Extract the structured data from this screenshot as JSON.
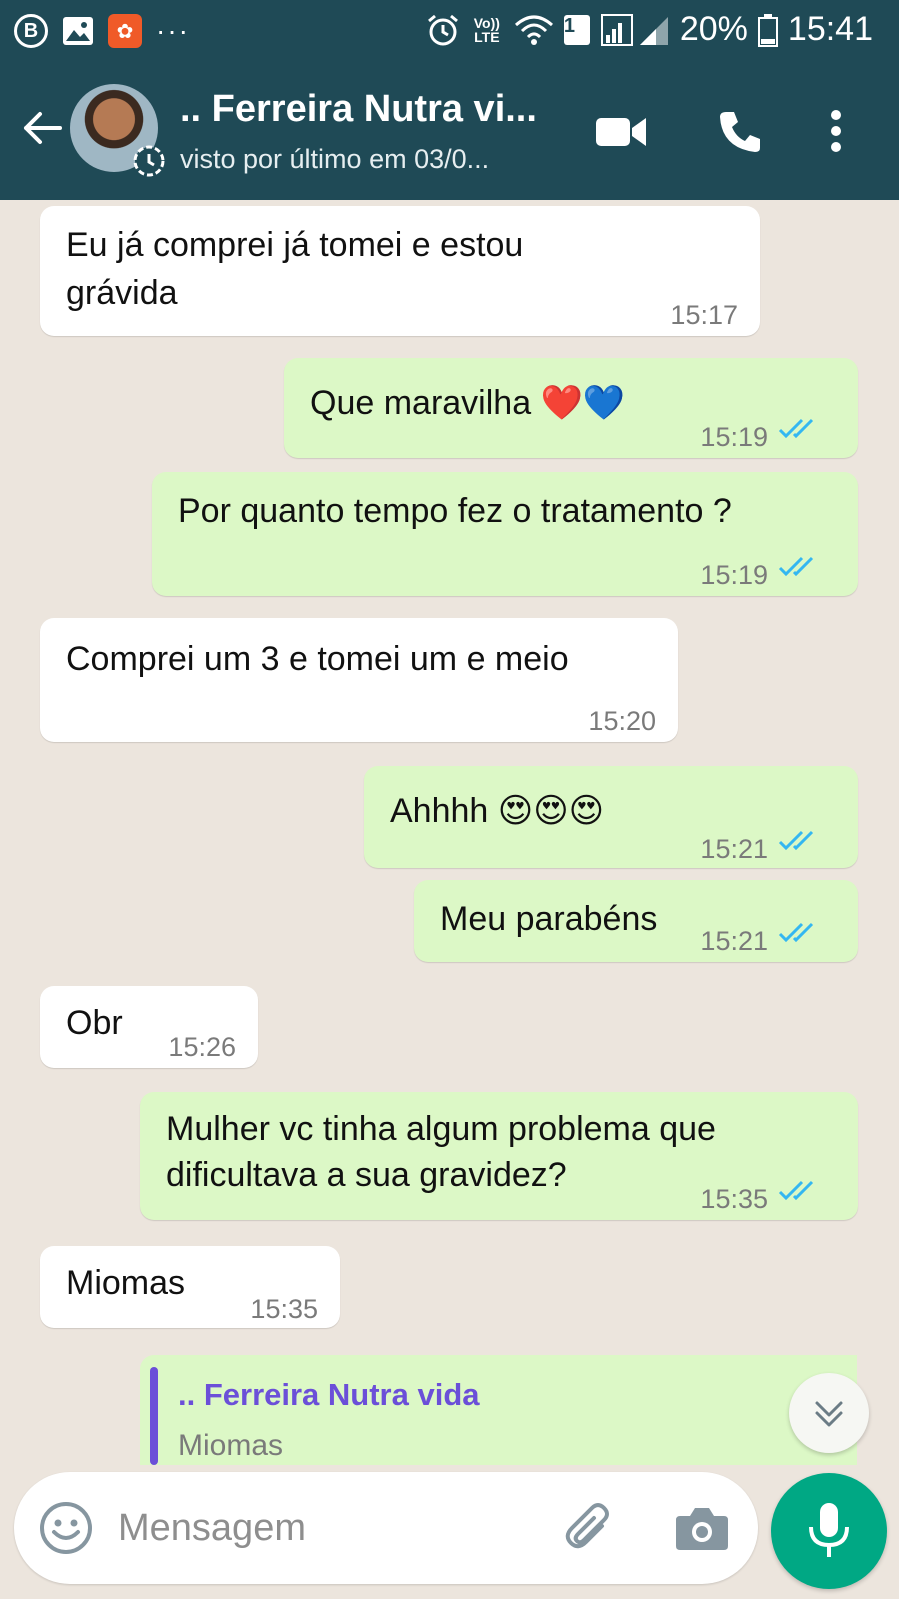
{
  "status_bar": {
    "battery": "20%",
    "time": "15:41",
    "volte": "Vo)) LTE",
    "sim": "1",
    "app_badge_letter": "B",
    "more_dots": "···"
  },
  "header": {
    "contact_name": ".. Ferreira Nutra vi...",
    "last_seen": "visto por último em 03/0...",
    "background_color": "#1f4a56"
  },
  "messages": [
    {
      "dir": "in",
      "lines": [
        "Eu já comprei já tomei e estou",
        "grávida"
      ],
      "time": "15:17"
    },
    {
      "dir": "out",
      "lines": [
        "Que maravilha ❤️💙"
      ],
      "time": "15:19",
      "read": true
    },
    {
      "dir": "out",
      "lines": [
        "Por quanto tempo fez o tratamento ?"
      ],
      "time": "15:19",
      "read": true
    },
    {
      "dir": "in",
      "lines": [
        "Comprei um 3 e tomei um e meio"
      ],
      "time": "15:20"
    },
    {
      "dir": "out",
      "lines": [
        "Ahhhh 😍😍😍"
      ],
      "time": "15:21",
      "read": true
    },
    {
      "dir": "out",
      "lines": [
        "Meu parabéns"
      ],
      "time": "15:21",
      "read": true
    },
    {
      "dir": "in",
      "lines": [
        "Obr"
      ],
      "time": "15:26"
    },
    {
      "dir": "out",
      "lines": [
        "Mulher vc tinha algum problema que",
        "dificultava a sua gravidez?"
      ],
      "time": "15:35",
      "read": true
    },
    {
      "dir": "in",
      "lines": [
        "Miomas"
      ],
      "time": "15:35"
    }
  ],
  "quoted_reply": {
    "author": ".. Ferreira Nutra vida",
    "text": "Miomas"
  },
  "input": {
    "placeholder": "Mensagem"
  },
  "colors": {
    "incoming_bubble": "#ffffff",
    "outgoing_bubble": "#dcf8c6",
    "read_ticks": "#34b7f1",
    "mic_button": "#00a884",
    "chat_background": "#ece5dd"
  },
  "icons": [
    "back-arrow-icon",
    "video-call-icon",
    "phone-icon",
    "more-vert-icon",
    "emoji-icon",
    "attach-icon",
    "camera-icon",
    "mic-icon",
    "scroll-down-icon"
  ]
}
